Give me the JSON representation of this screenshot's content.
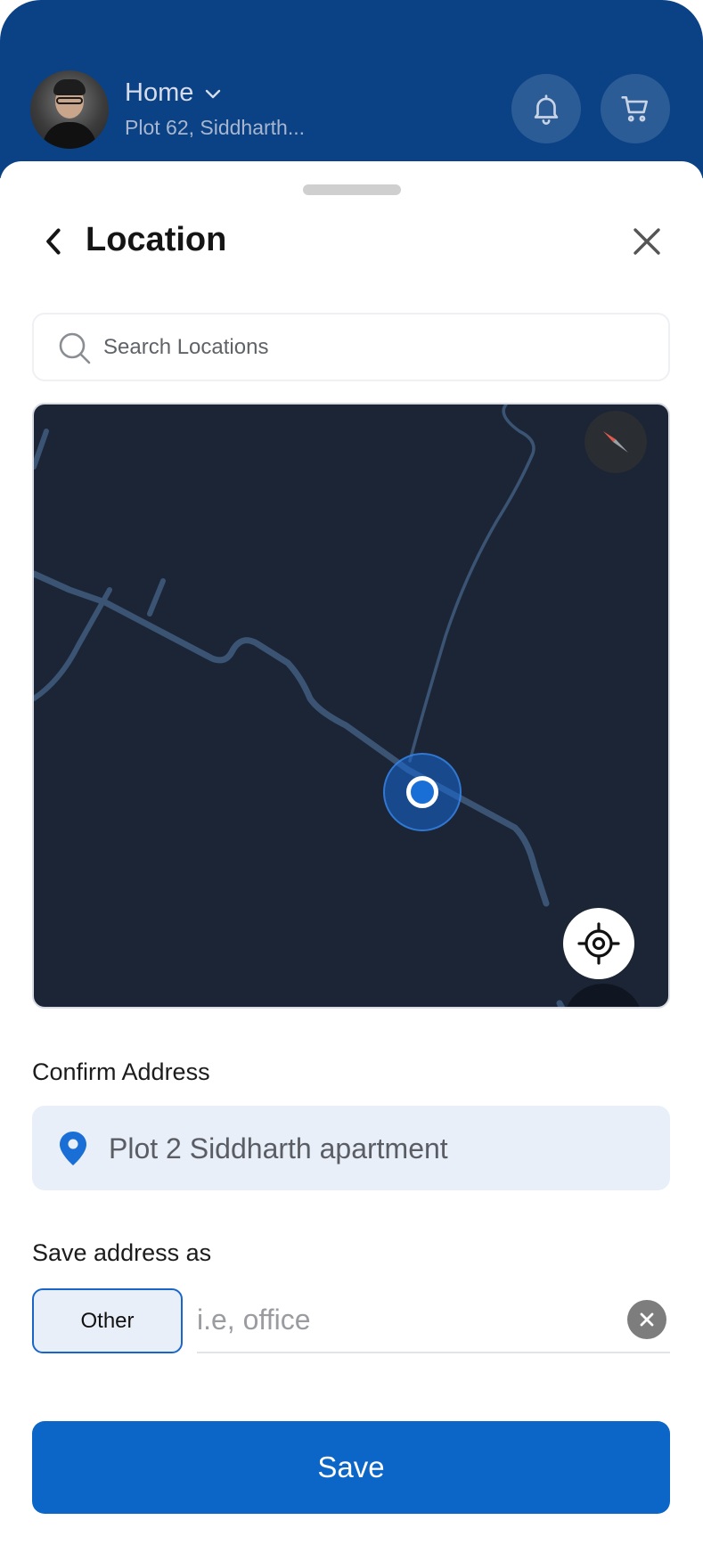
{
  "header": {
    "location_name": "Home",
    "location_address": "Plot 62, Siddharth...",
    "icons": {
      "avatar": "user-avatar",
      "dropdown": "chevron-down-icon",
      "notifications": "bell-icon",
      "cart": "cart-icon"
    }
  },
  "sheet": {
    "title": "Location",
    "icons": {
      "back": "chevron-left-icon",
      "close": "close-icon"
    }
  },
  "search": {
    "placeholder": "Search Locations",
    "value": "",
    "icon": "search-icon"
  },
  "map": {
    "theme": "dark",
    "colors": {
      "background": "#1b2535",
      "road": "#3b5474",
      "marker": "#1a6fd6"
    },
    "icons": {
      "compass": "compass-icon",
      "recenter": "crosshair-icon",
      "marker": "location-dot"
    }
  },
  "confirm": {
    "label": "Confirm Address",
    "address": "Plot 2 Siddharth apartment",
    "icon": "map-pin-icon"
  },
  "save_as": {
    "label": "Save address as",
    "chip_label": "Other",
    "input_placeholder": "i.e, office",
    "input_value": "",
    "clear_icon": "clear-icon"
  },
  "actions": {
    "save_label": "Save"
  },
  "colors": {
    "primary": "#0c66c7",
    "header_bg": "#0a4285",
    "chip_bg": "#e8eff9"
  }
}
